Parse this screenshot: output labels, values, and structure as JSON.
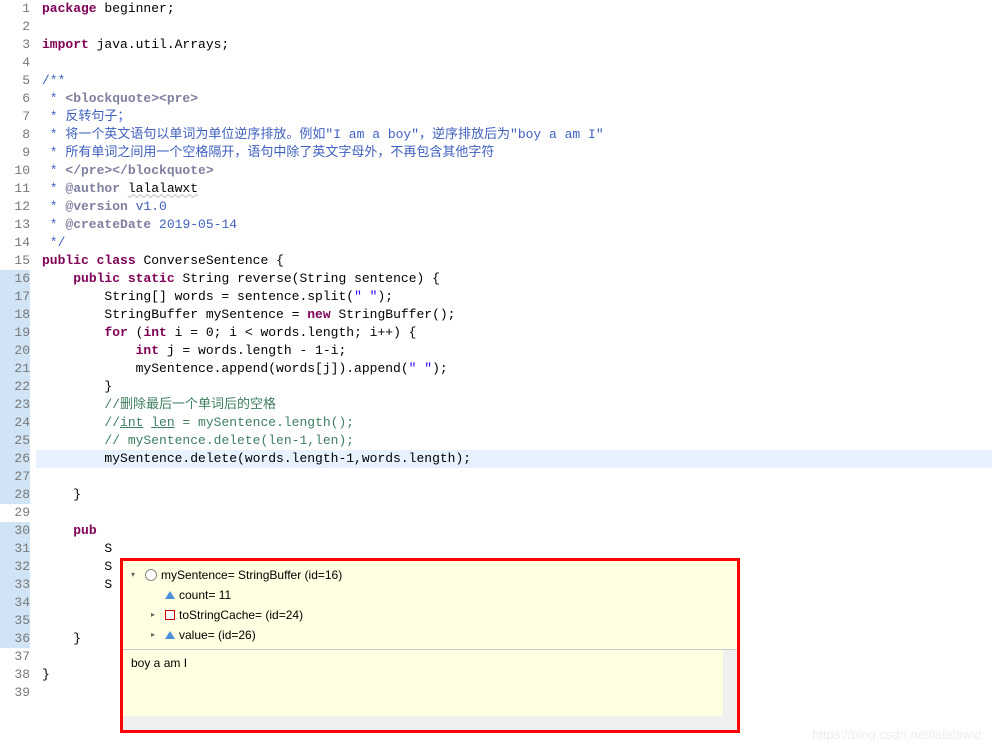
{
  "lines": [
    {
      "n": 1,
      "html": "<span class='kw'>package</span> beginner;"
    },
    {
      "n": 2,
      "html": ""
    },
    {
      "n": 3,
      "html": "<span class='kw'>import</span> java.util.Arrays;",
      "marker": "warn"
    },
    {
      "n": 4,
      "html": ""
    },
    {
      "n": 5,
      "html": "<span class='doc'>/**</span>",
      "fold": "⊖"
    },
    {
      "n": 6,
      "html": "<span class='doc'> * </span><span class='doctag'>&lt;blockquote&gt;&lt;pre&gt;</span>"
    },
    {
      "n": 7,
      "html": "<span class='doc'> * </span><span class='zh'>反转句子；</span>"
    },
    {
      "n": 8,
      "html": "<span class='doc'> * </span><span class='zh'>将一个英文语句以单词为单位逆序排放。例如\"I am a boy\"，逆序排放后为\"boy a am I\"</span>"
    },
    {
      "n": 9,
      "html": "<span class='doc'> * </span><span class='zh'>所有单词之间用一个空格隔开，语句中除了英文字母外，不再包含其他字符</span>"
    },
    {
      "n": 10,
      "html": "<span class='doc'> * </span><span class='doctag'>&lt;/pre&gt;&lt;/blockquote&gt;</span>"
    },
    {
      "n": 11,
      "html": "<span class='doc'> * </span><span class='doctag'>@author</span><span class='doc'> </span><span class='underline'>lalalawxt</span>"
    },
    {
      "n": 12,
      "html": "<span class='doc'> * </span><span class='doctag'>@version</span><span class='doc'> v1.0</span>"
    },
    {
      "n": 13,
      "html": "<span class='doc'> * </span><span class='doctag'>@createDate</span><span class='doc'> 2019-05-14</span>"
    },
    {
      "n": 14,
      "html": "<span class='doc'> */</span>"
    },
    {
      "n": 15,
      "html": "<span class='kw'>public</span> <span class='kw'>class</span> ConverseSentence {"
    },
    {
      "n": 16,
      "html": "    <span class='kw'>public</span> <span class='kw'>static</span> String reverse(String sentence) {",
      "fold": "⊖",
      "hl": true
    },
    {
      "n": 17,
      "html": "        String[] words = sentence.split(<span class='str'>\" \"</span>);",
      "hl": true
    },
    {
      "n": 18,
      "html": "        StringBuffer mySentence = <span class='kw'>new</span> StringBuffer();",
      "hl": true
    },
    {
      "n": 19,
      "html": "        <span class='kw'>for</span> (<span class='kw'>int</span> i = 0; i &lt; words.length; i++) {",
      "hl": true
    },
    {
      "n": 20,
      "html": "            <span class='kw'>int</span> j = words.length - 1-i;",
      "hl": true
    },
    {
      "n": 21,
      "html": "            mySentence.append(words[j]).append(<span class='str'>\" \"</span>);",
      "hl": true
    },
    {
      "n": 22,
      "html": "        }",
      "hl": true
    },
    {
      "n": 23,
      "html": "        <span class='cmt'>//删除最后一个单词后的空格</span>",
      "hl": true
    },
    {
      "n": 24,
      "html": "        <span class='cmt'>//<span style='text-decoration:underline'>int</span> <span style='text-decoration:underline'>len</span> = mySentence.length();</span>",
      "hl": true
    },
    {
      "n": 25,
      "html": "        <span class='cmt'>// mySentence.delete(len-1,len);</span>",
      "hl": true
    },
    {
      "n": 26,
      "html": "        mySentence.delete(words.length-1,words.length);",
      "hl": true,
      "current": true,
      "marker": "arrow"
    },
    {
      "n": 27,
      "html": "",
      "hl": true
    },
    {
      "n": 28,
      "html": "    }",
      "hl": true
    },
    {
      "n": 29,
      "html": ""
    },
    {
      "n": 30,
      "html": "    <span class='kw'>pub</span>",
      "fold": "⊖",
      "hl": true
    },
    {
      "n": 31,
      "html": "        S",
      "hl": true
    },
    {
      "n": 32,
      "html": "        S",
      "hl": true
    },
    {
      "n": 33,
      "html": "        S",
      "hl": true
    },
    {
      "n": 34,
      "html": "",
      "hl": true
    },
    {
      "n": 35,
      "html": "",
      "hl": true
    },
    {
      "n": 36,
      "html": "    }",
      "hl": true
    },
    {
      "n": 37,
      "html": ""
    },
    {
      "n": 38,
      "html": "}"
    },
    {
      "n": 39,
      "html": ""
    }
  ],
  "debug": {
    "header": "mySentence= StringBuffer  (id=16)",
    "rows": [
      {
        "icon": "tri-blue",
        "label": "count= 11"
      },
      {
        "icon": "sq",
        "label": "toStringCache= (id=24)",
        "expand": true
      },
      {
        "icon": "tri-blue",
        "label": "value= (id=26)",
        "expand": true
      }
    ],
    "output": "boy a am I "
  },
  "watermark": "https://blog.csdn.net/lalalawxt"
}
